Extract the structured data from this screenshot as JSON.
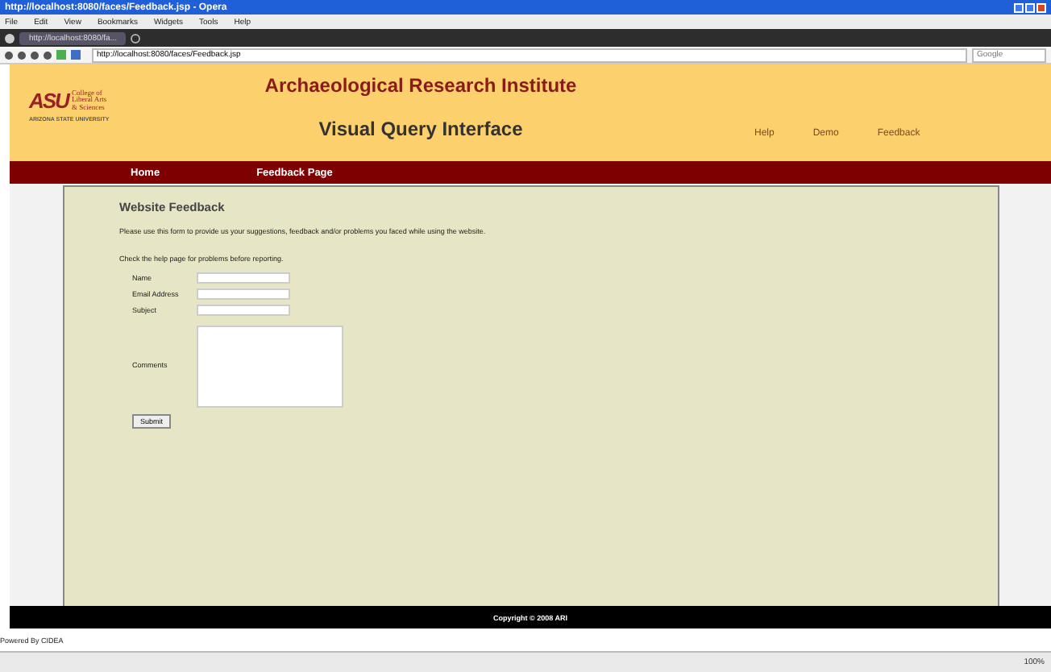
{
  "browser": {
    "title": "http://localhost:8080/faces/Feedback.jsp - Opera",
    "menu": [
      "File",
      "Edit",
      "View",
      "Bookmarks",
      "Widgets",
      "Tools",
      "Help"
    ],
    "tabs": [
      {
        "label": "http://localhost:8080/fa...",
        "selected": true
      }
    ],
    "address": "http://localhost:8080/faces/Feedback.jsp",
    "search": {
      "placeholder": "Google"
    },
    "zoom": "100%"
  },
  "header": {
    "logo": {
      "mark": "ASU",
      "college": [
        "College of",
        "Liberal Arts",
        "& Sciences"
      ],
      "university": "ARIZONA STATE UNIVERSITY"
    },
    "title": "Archaeological Research Institute",
    "subtitle": "Visual Query Interface",
    "links": [
      "Help",
      "Demo",
      "Feedback"
    ]
  },
  "nav": [
    "Home",
    "Feedback Page"
  ],
  "form": {
    "heading": "Website Feedback",
    "intro": "Please use this form to provide us your suggestions, feedback and/or problems you faced while using the website.",
    "note": "Check the help page for problems before reporting.",
    "fields": [
      {
        "label": "Name",
        "kind": "input"
      },
      {
        "label": "Email Address",
        "kind": "input"
      },
      {
        "label": "Subject",
        "kind": "input"
      },
      {
        "label": "Comments",
        "kind": "textarea"
      }
    ],
    "submit": "Submit"
  },
  "footer": "Copyright © 2008 ARI",
  "powered": "Powered By CIDEA"
}
